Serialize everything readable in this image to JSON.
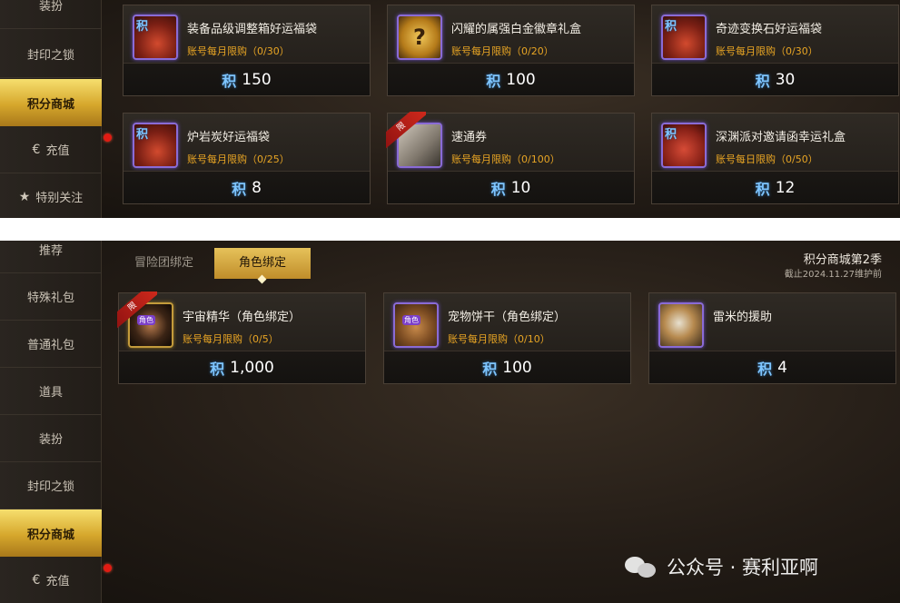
{
  "points_glyph": "积",
  "top": {
    "sidebar": [
      {
        "label": "装扮"
      },
      {
        "label": "封印之锁"
      },
      {
        "label": "积分商城",
        "active": true
      },
      {
        "label": "充值",
        "icon": "recharge-icon"
      },
      {
        "label": "特别关注",
        "icon": "star-icon"
      }
    ],
    "items": [
      {
        "name": "装备品级调整箱好运福袋",
        "limit": "账号每月限购（0/30）",
        "price": "150",
        "icon": "lucky-bag-equipment-icon"
      },
      {
        "name": "闪耀的属强白金徽章礼盒",
        "limit": "账号每月限购（0/20）",
        "price": "100",
        "icon": "mystery-box-icon"
      },
      {
        "name": "奇迹变换石好运福袋",
        "limit": "账号每月限购（0/30）",
        "price": "30",
        "icon": "lucky-bag-crystal-icon"
      },
      {
        "name": "炉岩炭好运福袋",
        "limit": "账号每月限购（0/25）",
        "price": "8",
        "icon": "lucky-bag-gem-icon"
      },
      {
        "name": "速通券",
        "limit": "账号每月限购（0/100）",
        "price": "10",
        "icon": "ticket-icon",
        "ribbon": "限"
      },
      {
        "name": "深渊派对邀请函幸运礼盒",
        "limit": "账号每日限购（0/50）",
        "price": "12",
        "icon": "gift-box-icon"
      }
    ]
  },
  "bottom": {
    "sidebar": [
      {
        "label": "推荐"
      },
      {
        "label": "特殊礼包"
      },
      {
        "label": "普通礼包"
      },
      {
        "label": "道具"
      },
      {
        "label": "装扮"
      },
      {
        "label": "封印之锁"
      },
      {
        "label": "积分商城",
        "active": true
      },
      {
        "label": "充值",
        "icon": "recharge-icon"
      }
    ],
    "tabs": [
      {
        "label": "冒险团绑定"
      },
      {
        "label": "角色绑定",
        "active": true
      }
    ],
    "season_title": "积分商城第2季",
    "season_note": "截止2024.11.27维护前",
    "items": [
      {
        "name": "宇宙精华（角色绑定）",
        "limit": "账号每月限购（0/5）",
        "price": "1,000",
        "icon": "cosmic-essence-icon",
        "ribbon": "限",
        "badge": "角色"
      },
      {
        "name": "宠物饼干（角色绑定）",
        "limit": "账号每月限购（0/10）",
        "price": "100",
        "icon": "pet-cookie-icon",
        "badge": "角色"
      },
      {
        "name": "雷米的援助",
        "limit": "",
        "price": "4",
        "icon": "feather-icon"
      }
    ]
  },
  "watermark": "公众号 · 赛利亚啊",
  "colors": {
    "accent_gold": "#d6a72c",
    "limit_orange": "#e8a524",
    "points_blue": "#7ec5ff",
    "alert_red": "#e11b13"
  }
}
